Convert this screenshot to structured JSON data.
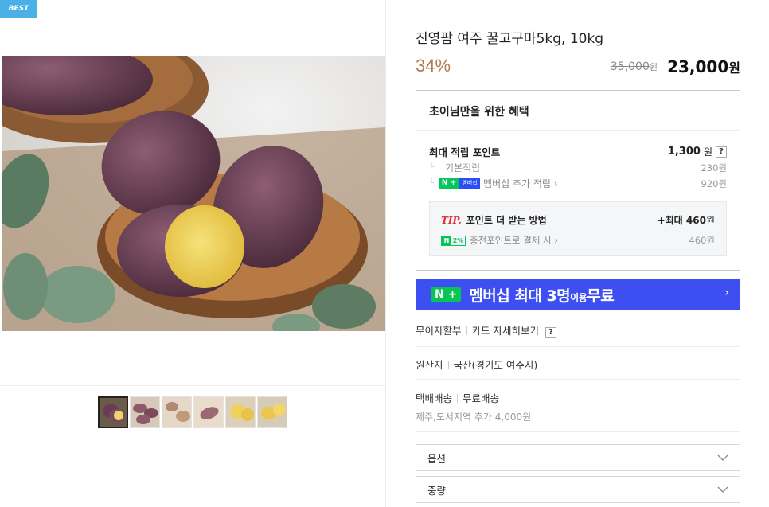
{
  "badge": "BEST",
  "product": {
    "title": "진영팜 여주 꿀고구마5kg, 10kg",
    "discount": "34%",
    "original_price": "35,000",
    "original_price_unit": "원",
    "sale_price": "23,000",
    "sale_price_unit": "원"
  },
  "benefits": {
    "header": "초이님만을 위한 혜택",
    "max_points_label": "최대 적립 포인트",
    "max_points_value": "1,300",
    "max_points_unit": "원",
    "help": "?",
    "basic_label": "기본적립",
    "basic_value": "230원",
    "membership_badge_n": "N +",
    "membership_badge_m": "멤버십",
    "membership_label": "멤버십 추가 적립",
    "membership_value": "920원",
    "tip_word": "TIP.",
    "tip_label": "포인트 더 받는 방법",
    "tip_value_prefix": "+최대",
    "tip_value": "460",
    "tip_value_unit": "원",
    "charge_badge_n": "N",
    "charge_badge_p": "2%",
    "charge_label": "충전포인트로 결제 시",
    "charge_value": "460원"
  },
  "membership_banner": {
    "badge": "N +",
    "text_main": "멤버십 최대 3명",
    "text_small": "이용",
    "text_end": "무료"
  },
  "info": {
    "installment": "무이자할부",
    "card_detail": "카드 자세히보기",
    "help": "?",
    "origin_label": "원산지",
    "origin_value": "국산(경기도 여주시)",
    "delivery_label": "택배배송",
    "delivery_value": "무료배송",
    "delivery_extra": "제주,도서지역 추가 4,000원"
  },
  "selects": {
    "option_label": "옵션",
    "weight_label": "중량"
  },
  "colors": {
    "discount": "#b07a55",
    "banner": "#3d4ff0",
    "naver_green": "#03c75a",
    "badge_blue": "#4ab0e6"
  }
}
